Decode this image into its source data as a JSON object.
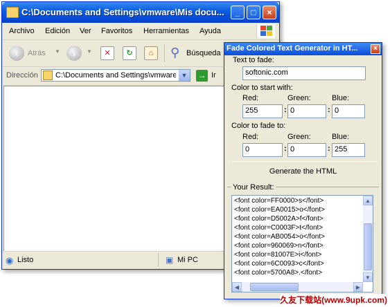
{
  "explorer": {
    "title": "C:\\Documents and Settings\\vmware\\Mis docu...",
    "menu": [
      "Archivo",
      "Edición",
      "Ver",
      "Favoritos",
      "Herramientas",
      "Ayuda"
    ],
    "toolbar": {
      "back_label": "Atrás",
      "search_label": "Búsqueda"
    },
    "address": {
      "label": "Dirección",
      "value": "C:\\Documents and Settings\\vmware\\",
      "go_label": "Ir"
    },
    "status": {
      "left": "Listo",
      "right": "Mi PC"
    }
  },
  "fade": {
    "title": "Fade Colored Text Generator in HT...",
    "close_glyph": "×",
    "text_label": "Text to fade:",
    "text_value": "softonic.com",
    "start_label": "Color to start with:",
    "fade_label": "Color to fade to:",
    "red_label": "Red:",
    "green_label": "Green:",
    "blue_label": "Blue:",
    "start": {
      "red": "255",
      "green": "0",
      "blue": "0"
    },
    "end": {
      "red": "0",
      "green": "0",
      "blue": "255"
    },
    "generate_label": "Generate the HTML",
    "result_label": "Your Result:",
    "result_lines": [
      "<font color=FF0000>s</font>",
      "<font color=EA0015>o</font>",
      "<font color=D5002A>f</font>",
      "<font color=C0003F>t</font>",
      "<font color=AB0054>o</font>",
      "<font color=960069>n</font>",
      "<font color=81007E>i</font>",
      "<font color=6C0093>c</font>",
      "<font color=5700A8>.</font>"
    ]
  },
  "watermark": "久友下载站(www.9upk.com)",
  "colors": {
    "xp_blue": "#0a4fd8",
    "window_bg": "#ece9d8",
    "watermark_red": "#b30000"
  }
}
